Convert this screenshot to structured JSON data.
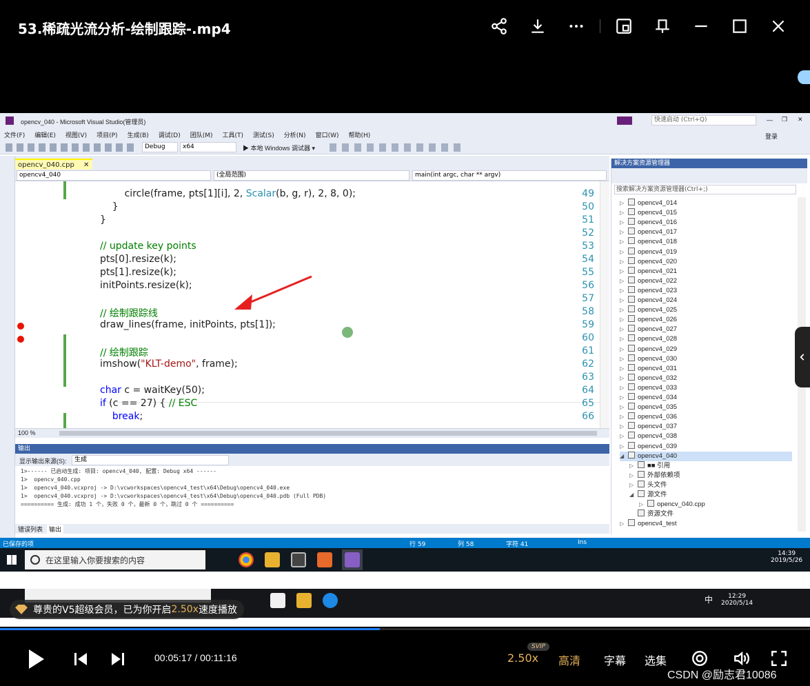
{
  "player": {
    "title": "53.稀疏光流分析-绘制跟踪-.mp4",
    "current_time": "00:05:17",
    "total_time": "00:11:16",
    "time_sep": " / ",
    "progress": 0.469,
    "speed": "2.50x",
    "svip_badge": "SVIP",
    "quality": "高清",
    "subtitle": "字幕",
    "episodes": "选集",
    "toast_text_a": "尊贵的V5超级会员，已为你开启",
    "toast_speed": "2.50x",
    "toast_text_b": "速度播放",
    "watermark": "CSDN @励志君10086",
    "accent": "#e8b25a",
    "progress_color": "#1e7fff"
  },
  "vs": {
    "title": "opencv_040 - Microsoft Visual Studio(管理员)",
    "quick_launch": "快速启动 (Ctrl+Q)",
    "login": "登录",
    "menu": [
      "文件(F)",
      "编辑(E)",
      "视图(V)",
      "项目(P)",
      "生成(B)",
      "调试(D)",
      "团队(M)",
      "工具(T)",
      "测试(S)",
      "分析(N)",
      "窗口(W)",
      "帮助(H)"
    ],
    "toolbar": {
      "config": "Debug",
      "platform": "x64",
      "run": "▶ 本地 Windows 调试器 ▾"
    },
    "tab": "opencv_040.cpp",
    "nav": {
      "project": "opencv4_040",
      "scope": "(全局范围)",
      "func": "main(int argc, char ** argv)"
    },
    "zoom": "100 %",
    "code_lines": [
      {
        "n": "49",
        "t": "        circle(frame, pts[1][i], 2, Scalar(b, g, r), 2, 8, 0);"
      },
      {
        "n": "50",
        "t": "    }"
      },
      {
        "n": "51",
        "t": "}"
      },
      {
        "n": "52",
        "t": ""
      },
      {
        "n": "53",
        "t": "// update key points"
      },
      {
        "n": "54",
        "t": "pts[0].resize(k);"
      },
      {
        "n": "55",
        "t": "pts[1].resize(k);"
      },
      {
        "n": "56",
        "t": "initPoints.resize(k);"
      },
      {
        "n": "57",
        "t": ""
      },
      {
        "n": "58",
        "t": "// 绘制跟踪线"
      },
      {
        "n": "59",
        "t": "draw_lines(frame, initPoints, pts[1]);"
      },
      {
        "n": "60",
        "t": ""
      },
      {
        "n": "61",
        "t": "// 绘制跟踪"
      },
      {
        "n": "62",
        "t": "imshow(\"KLT-demo\", frame);"
      },
      {
        "n": "63",
        "t": ""
      },
      {
        "n": "64",
        "t": "char c = waitKey(50);"
      },
      {
        "n": "65",
        "t": "if (c == 27) { // ESC"
      },
      {
        "n": "66",
        "t": "    break;"
      }
    ],
    "output": {
      "header": "输出",
      "source_label": "显示输出来源(S):",
      "source_value": "生成",
      "text": "1>------ 已启动生成: 项目: opencv4_040, 配置: Debug x64 ------\n1>  opencv_040.cpp\n1>  opencv4_040.vcxproj -> D:\\vcworkspaces\\opencv4_test\\x64\\Debug\\opencv4_040.exe\n1>  opencv4_040.vcxproj -> D:\\vcworkspaces\\opencv4_test\\x64\\Debug\\opencv4_040.pdb (Full PDB)\n========== 生成: 成功 1 个，失败 0 个，最新 0 个，跳过 0 个 ==========",
      "tab_errors": "错误列表",
      "tab_output": "输出"
    },
    "solution": {
      "header": "解决方案资源管理器",
      "search": "搜索解决方案资源管理器(Ctrl+;)",
      "projects": [
        "opencv4_014",
        "opencv4_015",
        "opencv4_016",
        "opencv4_017",
        "opencv4_018",
        "opencv4_019",
        "opencv4_020",
        "opencv4_021",
        "opencv4_022",
        "opencv4_023",
        "opencv4_024",
        "opencv4_025",
        "opencv4_026",
        "opencv4_027",
        "opencv4_028",
        "opencv4_029",
        "opencv4_030",
        "opencv4_031",
        "opencv4_032",
        "opencv4_033",
        "opencv4_034",
        "opencv4_035",
        "opencv4_036",
        "opencv4_037",
        "opencv4_038",
        "opencv4_039"
      ],
      "open_project": "opencv4_040",
      "children": [
        "■■ 引用",
        "外部依赖项",
        "头文件",
        "源文件"
      ],
      "source_file": "opencv_040.cpp",
      "resource": "资源文件",
      "last": "opencv4_test"
    },
    "status": {
      "left": "已保存的项",
      "row": "行 59",
      "col": "列 58",
      "char": "字符 41",
      "mode": "Ins"
    }
  },
  "taskbar1": {
    "search_placeholder": "在这里输入你要搜索的内容",
    "time": "14:39",
    "date": "2019/5/26"
  },
  "taskbar2": {
    "time": "12:29",
    "date": "2020/5/14",
    "ime": "中"
  }
}
